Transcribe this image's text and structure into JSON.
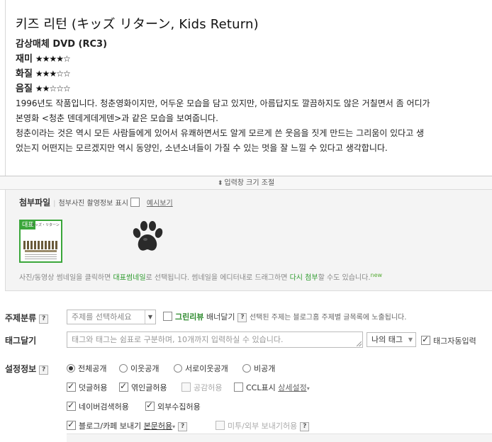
{
  "post": {
    "title": "키즈 리턴 (キッズ リターン, Kids Return)",
    "medium_label": "감상매체 DVD (RC3)",
    "ratings": [
      {
        "label": "재미",
        "stars": "★★★★☆"
      },
      {
        "label": "화질",
        "stars": "★★★☆☆"
      },
      {
        "label": "음질",
        "stars": "★★☆☆☆"
      }
    ],
    "paragraphs": [
      "1996년도 작품입니다. 청춘영화이지만, 어두운 모습을 담고 있지만, 아름답지도 깔끔하지도 않은 거칠면서 좀 어디가",
      "본영화 <청춘 덴데게데게덴>과 같은 모습을 보여줍니다.",
      "청춘이라는 것은 역시 모든 사람들에게 있어서 유쾌하면서도 알게 모르게 쓴 웃음을 짓게 만드는 그리움이 있다고 생",
      "었는지 어떤지는 모르겠지만 역시 동양인, 소년소녀들이 가질 수 있는 멋을 잘 느낄 수 있다고 생각합니다."
    ]
  },
  "resize_bar": {
    "label": "입력창 크기 조절"
  },
  "attach": {
    "title": "첨부파일",
    "photo_info_label": "첨부사진 촬영정보 표시",
    "example_link": "예시보기",
    "thumb_badge": "대표",
    "thumb_caption": "キッズ・リターン",
    "note_1": "사진/동영상 썸네일을 클릭하면 ",
    "note_2": "대표썸네일",
    "note_3": "로 선택됩니다. 썸네일을 에디터내로 드래그하면 ",
    "note_4": "다시 첨부",
    "note_5": "할 수도 있습니다.",
    "note_new": "new"
  },
  "topic": {
    "label": "주제분류",
    "select_value": "주제를 선택하세요",
    "green_review": "그린리뷰",
    "banner_label": " 배너달기",
    "info": "선택된 주제는 블로그홈 주제별 글목록에 노출됩니다."
  },
  "tags": {
    "label": "태그달기",
    "placeholder": "태그와 태그는 쉼표로 구분하며, 10개까지 입력하실 수 있습니다.",
    "my_tag": "나의 태그",
    "auto_tag": "태그자동입력"
  },
  "settings": {
    "label": "설정정보",
    "visibility": [
      "전체공개",
      "이웃공개",
      "서로이웃공개",
      "비공개"
    ],
    "allow_comment": "덧글허용",
    "allow_trackback": "엮인글허용",
    "allow_sympathy": "공감허용",
    "ccl": "CCL표시",
    "ccl_link": "상세설정",
    "naver_search": "네이버검색허용",
    "external_collect": "외부수집허용",
    "blog_cafe_send": "블로그/카페 보내기",
    "body_allow": "본문허용",
    "me2day_send": "미투/외부 보내기허용"
  },
  "colors": {
    "accent_green": "#3aa63a",
    "border": "#bbbbbb"
  }
}
